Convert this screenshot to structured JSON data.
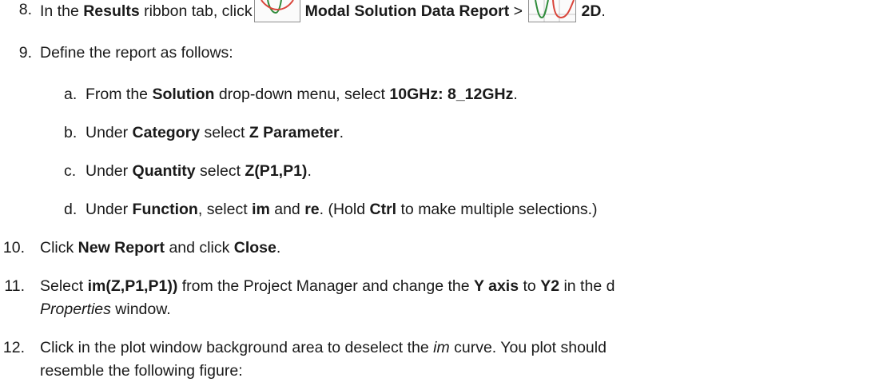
{
  "steps": {
    "s8": {
      "num": "8.",
      "t1": "In the ",
      "results": "Results",
      "t2": " ribbon tab, click",
      "report": "Modal Solution Data Report",
      "t3": " > ",
      "twod": "2D",
      "t4": "."
    },
    "s9": {
      "num": "9.",
      "text": "Define the report as follows:"
    },
    "a": {
      "letter": "a.",
      "t1": "From the ",
      "solution": "Solution",
      "t2": " drop-down menu, select ",
      "value": "10GHz: 8_12GHz",
      "t3": "."
    },
    "b": {
      "letter": "b.",
      "t1": "Under ",
      "category": "Category",
      "t2": " select ",
      "value": "Z Parameter",
      "t3": "."
    },
    "c": {
      "letter": "c.",
      "t1": "Under ",
      "quantity": "Quantity",
      "t2": " select ",
      "value": "Z(P1,P1)",
      "t3": "."
    },
    "d": {
      "letter": "d.",
      "t1": "Under ",
      "function": "Function",
      "t2": ", select ",
      "im": "im",
      "t3": " and ",
      "re": "re",
      "t4": ". (Hold ",
      "ctrl": "Ctrl",
      "t5": " to make multiple selections.)"
    },
    "s10": {
      "num": "10.",
      "t1": "Click ",
      "new_report": "New Report",
      "t2": " and click ",
      "close": "Close",
      "t3": "."
    },
    "s11": {
      "num": "11.",
      "t1": "Select ",
      "item": "im(Z,P1,P1))",
      "t2": " from the Project Manager and change the ",
      "y_axis": "Y axis",
      "t3": " to ",
      "y2": "Y2",
      "t4": " in the d",
      "properties": "Properties",
      "t5": " window."
    },
    "s12": {
      "num": "12.",
      "t1": "Click in the plot window background area to deselect the ",
      "im": "im",
      "t2": " curve. You plot should",
      "line2": "resemble the following figure:"
    }
  },
  "icons": {
    "modal_report": "modal-solution-data-report-icon",
    "rect_plot_2d": "2d-rectangular-plot-icon"
  },
  "colors": {
    "text": "#1a1a1a",
    "curve_green": "#2e8b3a",
    "curve_red": "#d9443a"
  }
}
